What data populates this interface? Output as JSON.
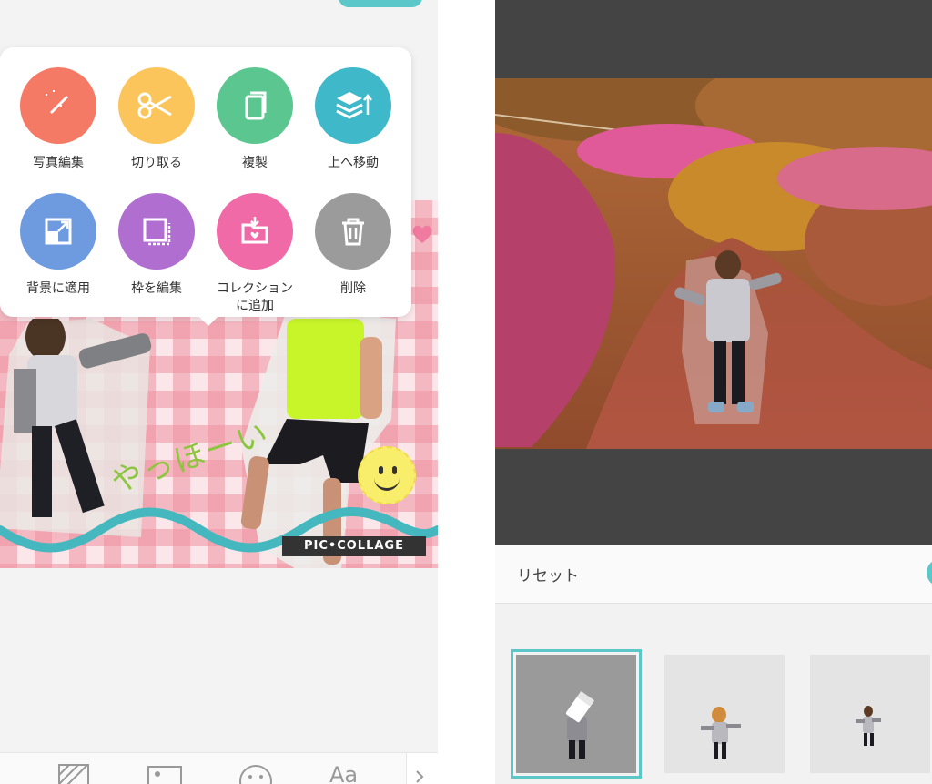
{
  "editor": {
    "menu": [
      {
        "label": "写真編集",
        "icon": "magic-wand-icon",
        "color": "#f47a66"
      },
      {
        "label": "切り取る",
        "icon": "scissors-icon",
        "color": "#fbc55b"
      },
      {
        "label": "複製",
        "icon": "duplicate-icon",
        "color": "#5cc690"
      },
      {
        "label": "上へ移動",
        "icon": "layer-up-icon",
        "color": "#3fb8c9"
      },
      {
        "label": "背景に適用",
        "icon": "apply-background-icon",
        "color": "#6e9be0"
      },
      {
        "label": "枠を編集",
        "icon": "frame-icon",
        "color": "#b06ed0"
      },
      {
        "label_line1": "コレクション",
        "label_line2": "に追加",
        "icon": "collection-add-icon",
        "color": "#f06aa8"
      },
      {
        "label": "削除",
        "icon": "trash-icon",
        "color": "#9b9b9b"
      }
    ],
    "collage_text": "やっほーい",
    "brand": "PIC•COLLAGE",
    "bottom_tabs": [
      "background-icon",
      "image-icon",
      "sticker-icon",
      "text-icon"
    ],
    "text_tab_glyph": "Aa"
  },
  "cutout": {
    "reset_label": "リセット",
    "accent": "#5cc7c9",
    "thumbnails": [
      "eraser-thumb",
      "original-thumb",
      "small-thumb"
    ]
  }
}
